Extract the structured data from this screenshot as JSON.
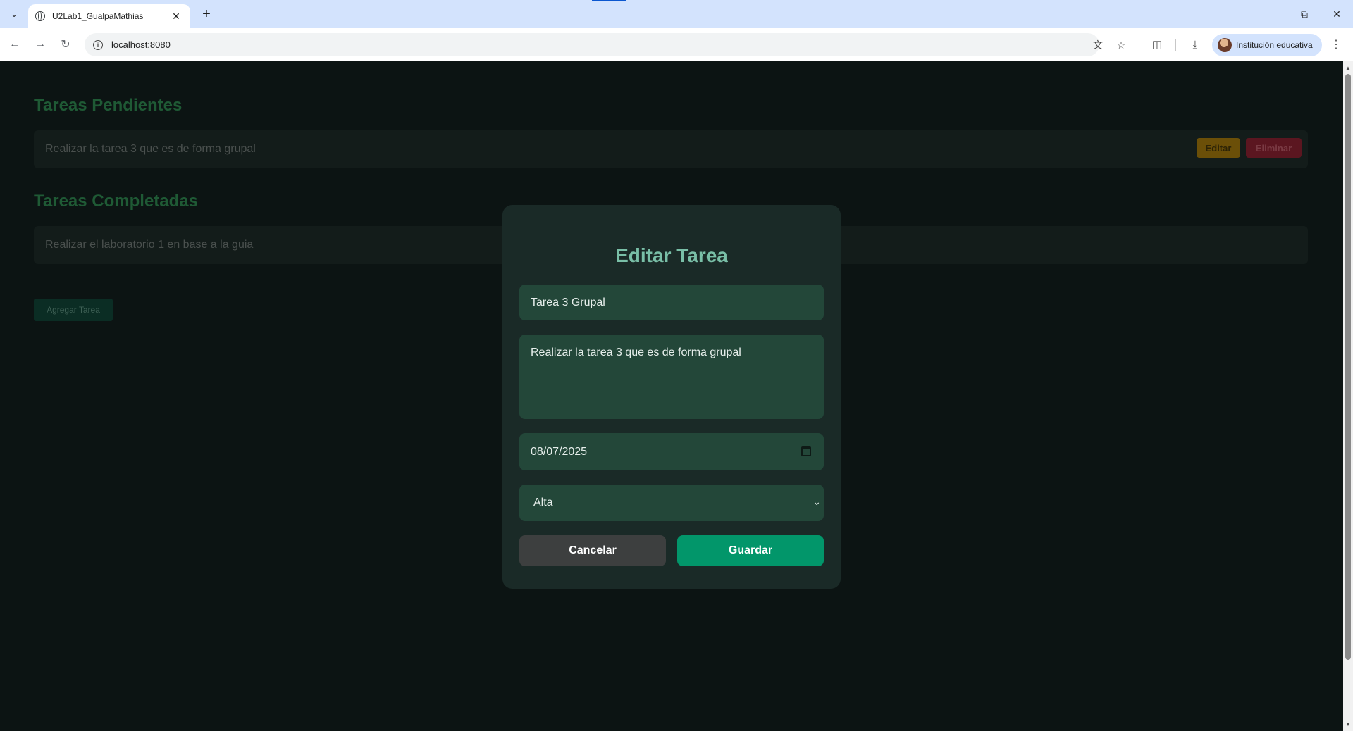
{
  "browser": {
    "tab_title": "U2Lab1_GualpaMathias",
    "url": "localhost:8080",
    "profile_label": "Institución educativa"
  },
  "page": {
    "pending_heading": "Tareas Pendientes",
    "pending_tasks": [
      {
        "text": "Realizar la tarea 3 que es de forma grupal",
        "edit_label": "Editar",
        "delete_label": "Eliminar"
      }
    ],
    "completed_heading": "Tareas Completadas",
    "completed_tasks": [
      {
        "text": "Realizar el laboratorio 1 en base a la guia"
      }
    ],
    "add_button_label": "Agregar Tarea"
  },
  "modal": {
    "title": "Editar Tarea",
    "task_title_value": "Tarea 3 Grupal",
    "description_value": "Realizar la tarea 3 que es de forma grupal",
    "date_value": "08/07/2025",
    "priority_value": "Alta",
    "cancel_label": "Cancelar",
    "save_label": "Guardar"
  },
  "colors": {
    "page_background": "#0c1413",
    "modal_background": "#1a2a27",
    "modal_title": "#79bfa7",
    "field_background": "#234739",
    "save_button": "#02966a",
    "cancel_button": "#3d3f3f"
  }
}
